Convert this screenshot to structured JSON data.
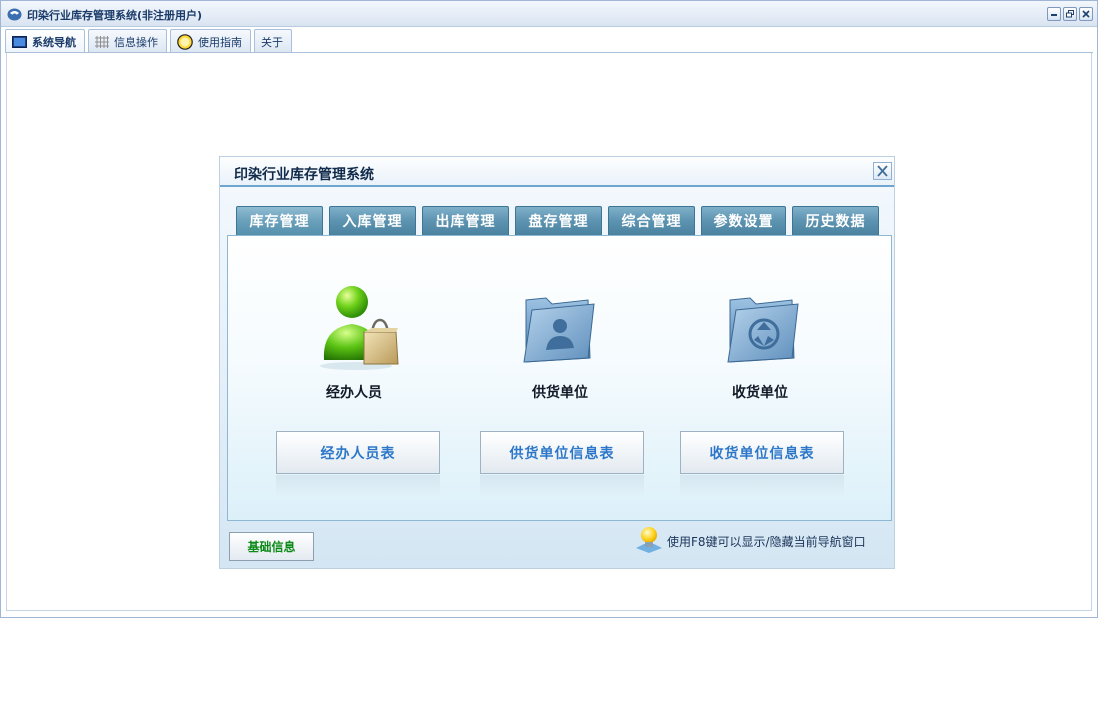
{
  "window": {
    "title": "印染行业库存管理系统(非注册用户)"
  },
  "top_tabs": [
    {
      "label": "系统导航",
      "icon": "monitor-icon"
    },
    {
      "label": "信息操作",
      "icon": "grid-icon"
    },
    {
      "label": "使用指南",
      "icon": "help-circle-icon"
    },
    {
      "label": "关于",
      "icon": ""
    }
  ],
  "dialog": {
    "title": "印染行业库存管理系统",
    "tabs": [
      "库存管理",
      "入库管理",
      "出库管理",
      "盘存管理",
      "综合管理",
      "参数设置",
      "历史数据"
    ],
    "items": [
      {
        "label": "经办人员",
        "icon": "user-bag-icon",
        "button": "经办人员表"
      },
      {
        "label": "供货单位",
        "icon": "folder-user-icon",
        "button": "供货单位信息表"
      },
      {
        "label": "收货单位",
        "icon": "folder-recycle-icon",
        "button": "收货单位信息表"
      }
    ],
    "footer_button": "基础信息",
    "hint": "使用F8键可以显示/隐藏当前导航窗口"
  },
  "colors": {
    "tab_blue": "#5c93b0",
    "link_blue": "#2c77c9",
    "footer_green": "#0d8a17"
  }
}
